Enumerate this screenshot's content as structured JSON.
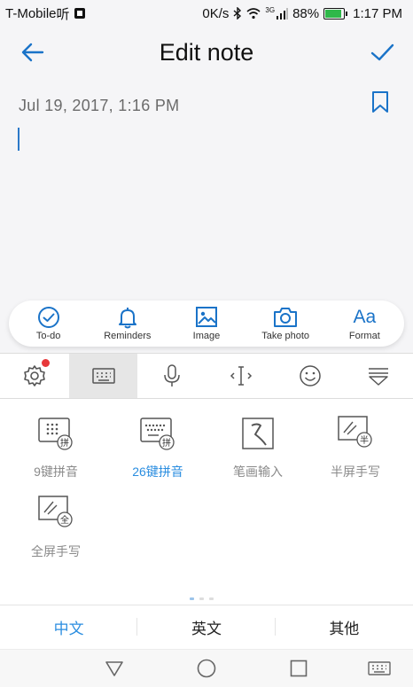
{
  "status_bar": {
    "carrier": "T-Mobile",
    "carrier_suffix": "听",
    "net_speed": "0K/s",
    "network_type": "3G",
    "battery": "88%",
    "battery_level": 0.88,
    "time": "1:17 PM"
  },
  "app_bar": {
    "title": "Edit note"
  },
  "note": {
    "date": "Jul 19, 2017, 1:16 PM"
  },
  "toolbar": {
    "items": [
      {
        "label": "To-do",
        "icon": "todo-check-icon"
      },
      {
        "label": "Reminders",
        "icon": "bell-icon"
      },
      {
        "label": "Image",
        "icon": "image-icon"
      },
      {
        "label": "Take photo",
        "icon": "camera-icon"
      },
      {
        "label": "Format",
        "icon": "format-text-icon",
        "glyph": "Aa"
      }
    ]
  },
  "keyboard": {
    "top_icons": [
      "settings-gear-icon",
      "keyboard-icon",
      "microphone-icon",
      "cursor-move-icon",
      "emoji-icon",
      "collapse-keyboard-icon"
    ],
    "selected_top": 1,
    "modes": [
      {
        "label": "9键拼音",
        "badge": "拼"
      },
      {
        "label": "26键拼音",
        "badge": "拼",
        "active": true
      },
      {
        "label": "笔画输入"
      },
      {
        "label": "半屏手写",
        "badge": "半"
      },
      {
        "label": "全屏手写",
        "badge": "全"
      }
    ],
    "languages": [
      "中文",
      "英文",
      "其他"
    ],
    "active_language": 0
  },
  "colors": {
    "accent": "#2b8ee0",
    "icon_blue": "#1a73c8",
    "notification_dot": "#e7383b",
    "battery_green": "#2fb84a"
  }
}
